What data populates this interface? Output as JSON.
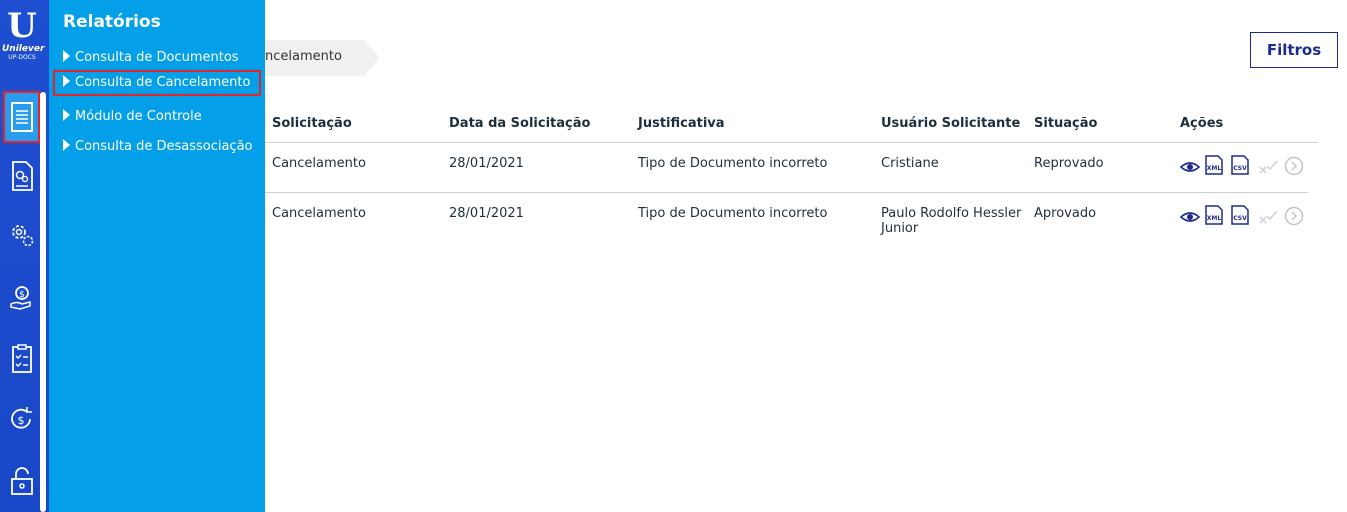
{
  "logo": {
    "brand": "Unilever",
    "subtitle": "UP-DOCS"
  },
  "menu": {
    "title": "Relatórios",
    "items": [
      {
        "label": "Consulta de Documentos"
      },
      {
        "label": "Consulta de Cancelamento"
      },
      {
        "label": "Módulo de Controle"
      },
      {
        "label": "Consulta de Desassociação"
      }
    ]
  },
  "breadcrumb": {
    "current": "Cancelamento"
  },
  "filters_button": "Filtros",
  "table": {
    "headers": [
      "Solicitação",
      "Data da Solicitação",
      "Justificativa",
      "Usuário Solicitante",
      "Situação",
      "Ações"
    ],
    "rows": [
      {
        "solicitacao": "Cancelamento",
        "data": "28/01/2021",
        "justificativa": "Tipo de Documento incorreto",
        "usuario": "Cristiane",
        "situacao": "Reprovado"
      },
      {
        "solicitacao": "Cancelamento",
        "data": "28/01/2021",
        "justificativa": "Tipo de Documento incorreto",
        "usuario_line1": "Paulo Rodolfo Hessler",
        "usuario_line2": "Junior",
        "situacao": "Aprovado"
      }
    ]
  },
  "action_icons": [
    "eye-icon",
    "xml-file-icon",
    "csv-file-icon",
    "approve-reject-icon",
    "chevron-right-circle-icon"
  ],
  "colors": {
    "sidebar": "#1f4fd0",
    "menu_panel": "#03a0e9",
    "highlight": "#e0262b",
    "accent": "#1b2b8e"
  }
}
